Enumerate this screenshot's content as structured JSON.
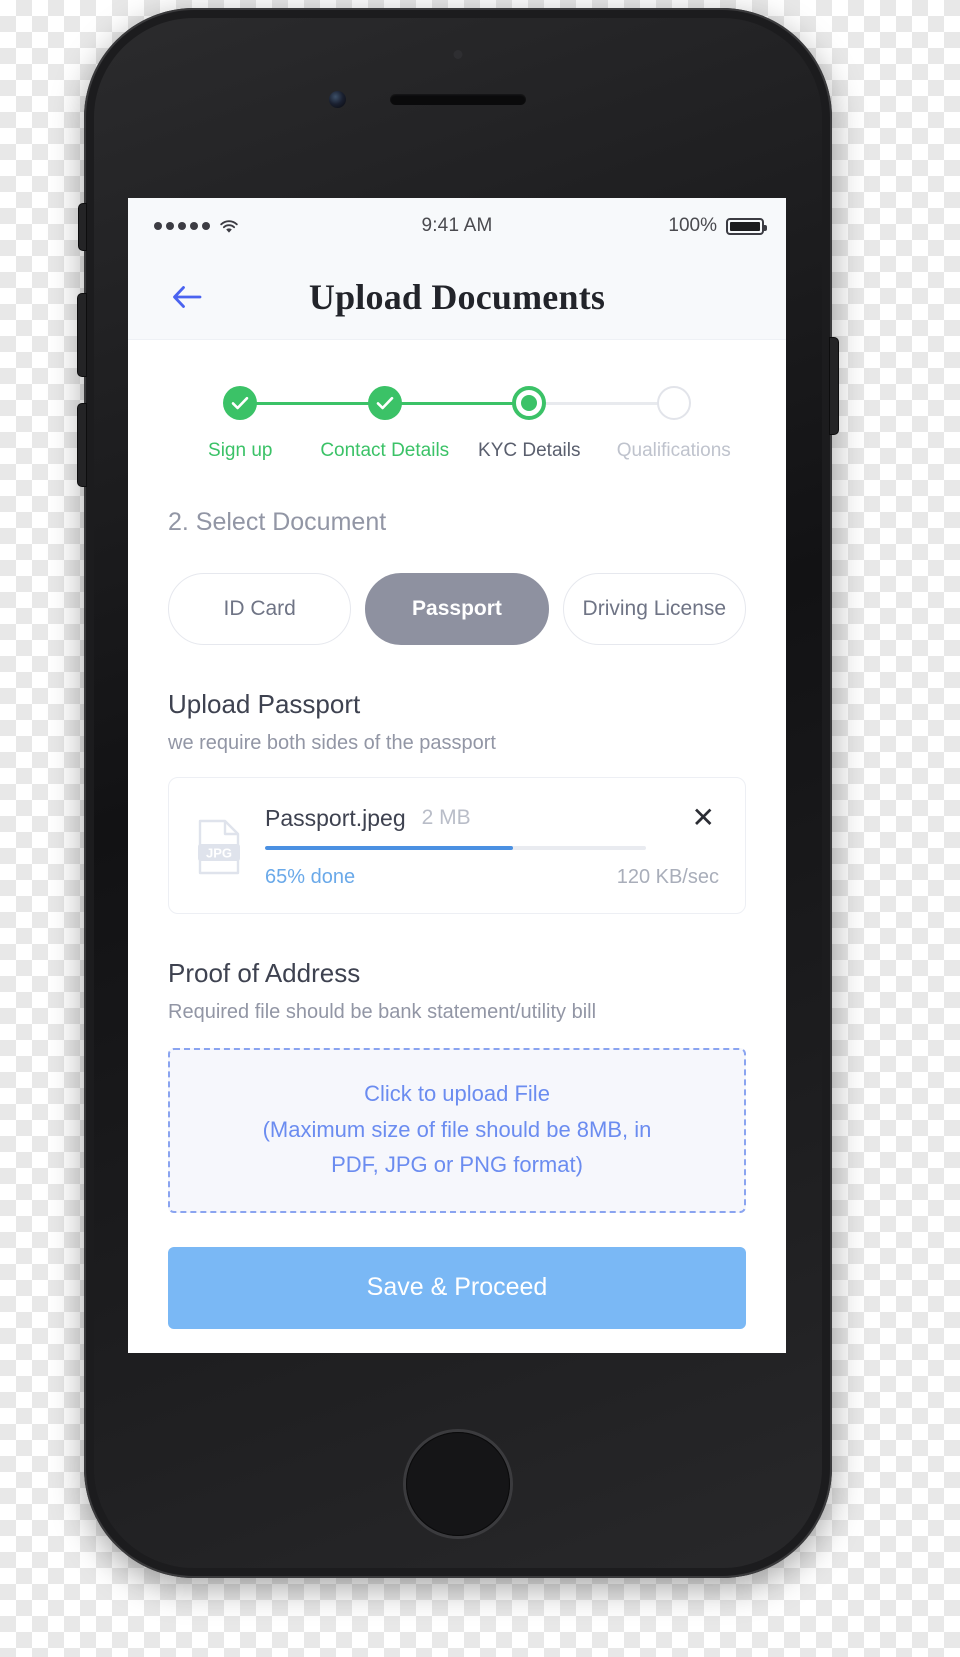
{
  "status_bar": {
    "signal_icon": "signal-dots-icon",
    "wifi_icon": "wifi-icon",
    "time": "9:41 AM",
    "battery_percent": "100%",
    "battery_icon": "battery-full-icon"
  },
  "header": {
    "back_icon": "back-arrow-icon",
    "title": "Upload Documents"
  },
  "stepper": {
    "steps": [
      {
        "label": "Sign up",
        "state": "done"
      },
      {
        "label": "Contact Details",
        "state": "done"
      },
      {
        "label": "KYC Details",
        "state": "active"
      },
      {
        "label": "Qualifications",
        "state": "todo"
      }
    ]
  },
  "select_document": {
    "section_title": "2. Select Document",
    "options": [
      {
        "label": "ID Card",
        "selected": false
      },
      {
        "label": "Passport",
        "selected": true
      },
      {
        "label": "Driving License",
        "selected": false
      }
    ]
  },
  "upload_passport": {
    "title": "Upload Passport",
    "subtitle": "we require both sides of the passport",
    "file": {
      "type_icon": "jpg-file-icon",
      "type_label": "JPG",
      "name": "Passport.jpeg",
      "size": "2 MB",
      "remove_icon": "close-icon",
      "progress_percent": 65,
      "progress_label": "65% done",
      "speed": "120 KB/sec"
    }
  },
  "proof_of_address": {
    "title": "Proof of Address",
    "subtitle": "Required file should be bank statement/utility bill",
    "dropzone": {
      "line1": "Click to upload File",
      "line2": "(Maximum size of file should be 8MB, in",
      "line3": "PDF, JPG or PNG format)"
    }
  },
  "footer": {
    "save_label": "Save & Proceed"
  },
  "colors": {
    "step_done": "#3bc267",
    "accent_blue": "#4a90e2",
    "save_button": "#7ab8f5",
    "chip_selected": "#8e91a0",
    "dropzone_border": "#8aa4f0",
    "back_arrow": "#4a63f0"
  }
}
